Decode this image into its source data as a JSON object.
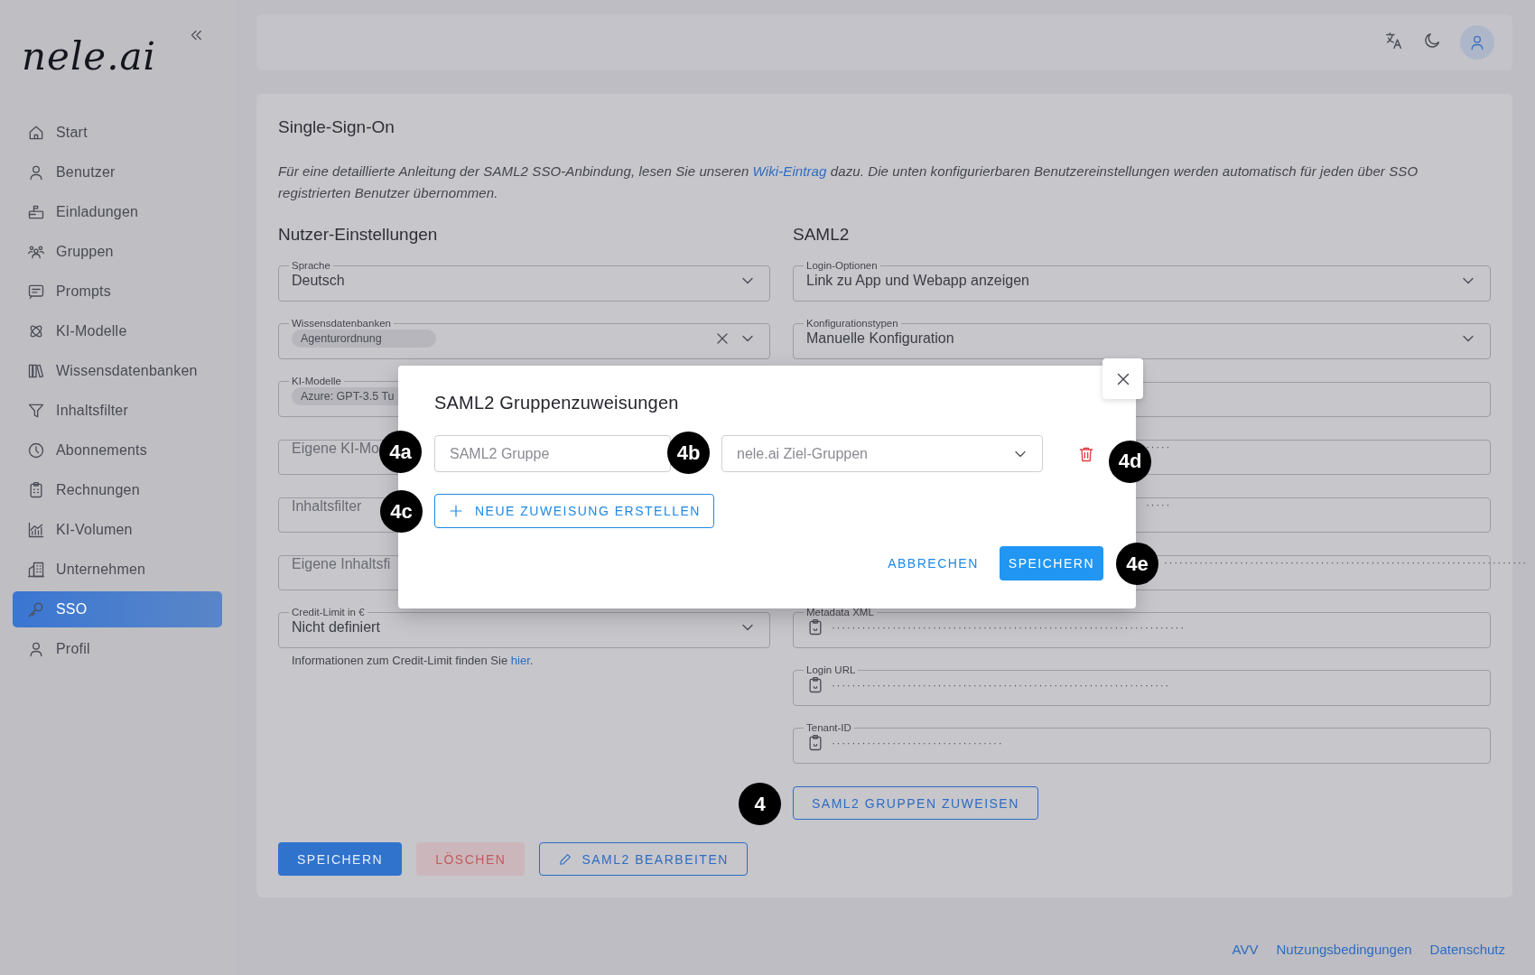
{
  "sidebar": {
    "logo": "nele.ai",
    "items": [
      {
        "label": "Start",
        "selected": false
      },
      {
        "label": "Benutzer",
        "selected": false
      },
      {
        "label": "Einladungen",
        "selected": false
      },
      {
        "label": "Gruppen",
        "selected": false
      },
      {
        "label": "Prompts",
        "selected": false
      },
      {
        "label": "KI-Modelle",
        "selected": false
      },
      {
        "label": "Wissensdatenbanken",
        "selected": false
      },
      {
        "label": "Inhaltsfilter",
        "selected": false
      },
      {
        "label": "Abonnements",
        "selected": false
      },
      {
        "label": "Rechnungen",
        "selected": false
      },
      {
        "label": "KI-Volumen",
        "selected": false
      },
      {
        "label": "Unternehmen",
        "selected": false
      },
      {
        "label": "SSO",
        "selected": true
      },
      {
        "label": "Profil",
        "selected": false
      }
    ]
  },
  "card": {
    "title": "Single-Sign-On",
    "intro": {
      "before": "Für eine detaillierte Anleitung der SAML2 SSO-Anbindung, lesen Sie unseren ",
      "link": "Wiki-Eintrag",
      "after": " dazu. Die unten konfigurierbaren Benutzereinstellungen werden automatisch für jeden über SSO registrierten Benutzer übernommen."
    },
    "user_settings": {
      "heading": "Nutzer-Einstellungen",
      "fields": [
        {
          "kind": "select",
          "label": "Sprache",
          "value": "Deutsch"
        },
        {
          "kind": "chips",
          "label": "Wissensdatenbanken",
          "chips": [
            "Agenturordnung"
          ],
          "clearable": true
        },
        {
          "kind": "chips",
          "label": "KI-Modelle",
          "chips": [
            "Azure: GPT-3.5 Tu"
          ]
        },
        {
          "kind": "text",
          "placeholder": "Eigene KI-Mo"
        },
        {
          "kind": "text",
          "placeholder": "Inhaltsfilter"
        },
        {
          "kind": "text",
          "placeholder": "Eigene Inhaltsfi"
        },
        {
          "kind": "select",
          "label": "Credit-Limit in €",
          "value": "Nicht definiert"
        }
      ],
      "hint": {
        "before": "Informationen zum Credit-Limit finden Sie ",
        "link": "hier",
        "after": "."
      }
    },
    "saml2": {
      "heading": "SAML2",
      "fields": [
        {
          "kind": "select",
          "label": "Login-Optionen",
          "value": "Link zu App und Webapp anzeigen"
        },
        {
          "kind": "select",
          "label": "Konfigurationstypen",
          "value": "Manuelle Konfiguration"
        },
        {
          "kind": "blank"
        },
        {
          "kind": "masked",
          "value": "·····"
        },
        {
          "kind": "masked",
          "value": "·····"
        },
        {
          "kind": "masked",
          "value": "········································································"
        },
        {
          "kind": "copy",
          "label": "Metadata XML",
          "value": "······································································"
        },
        {
          "kind": "copy",
          "label": "Login URL",
          "value": "···································································"
        },
        {
          "kind": "copy",
          "label": "Tenant-ID",
          "value": "··································"
        }
      ],
      "assign_button": {
        "label": "SAML2 GRUPPEN ZUWEISEN",
        "marker": "4"
      }
    },
    "actions": [
      {
        "label": "SPEICHERN",
        "kind": "primary"
      },
      {
        "label": "LÖSCHEN",
        "kind": "danger",
        "disabled": true
      },
      {
        "label": "SAML2 BEARBEITEN",
        "kind": "outlined"
      }
    ]
  },
  "modal": {
    "title": "SAML2 Gruppenzuweisungen",
    "group_field": {
      "placeholder": "SAML2 Gruppe",
      "marker": "4a"
    },
    "target_field": {
      "placeholder": "nele.ai Ziel-Gruppen",
      "marker": "4b"
    },
    "delete_marker": "4d",
    "add_button": {
      "label": "NEUE ZUWEISUNG ERSTELLEN",
      "marker": "4c"
    },
    "cancel_button": {
      "label": "ABBRECHEN"
    },
    "save_button": {
      "label": "SPEICHERN",
      "marker": "4e"
    }
  },
  "footer_links": [
    "AVV",
    "Nutzungsbedingungen",
    "Datenschutz"
  ]
}
